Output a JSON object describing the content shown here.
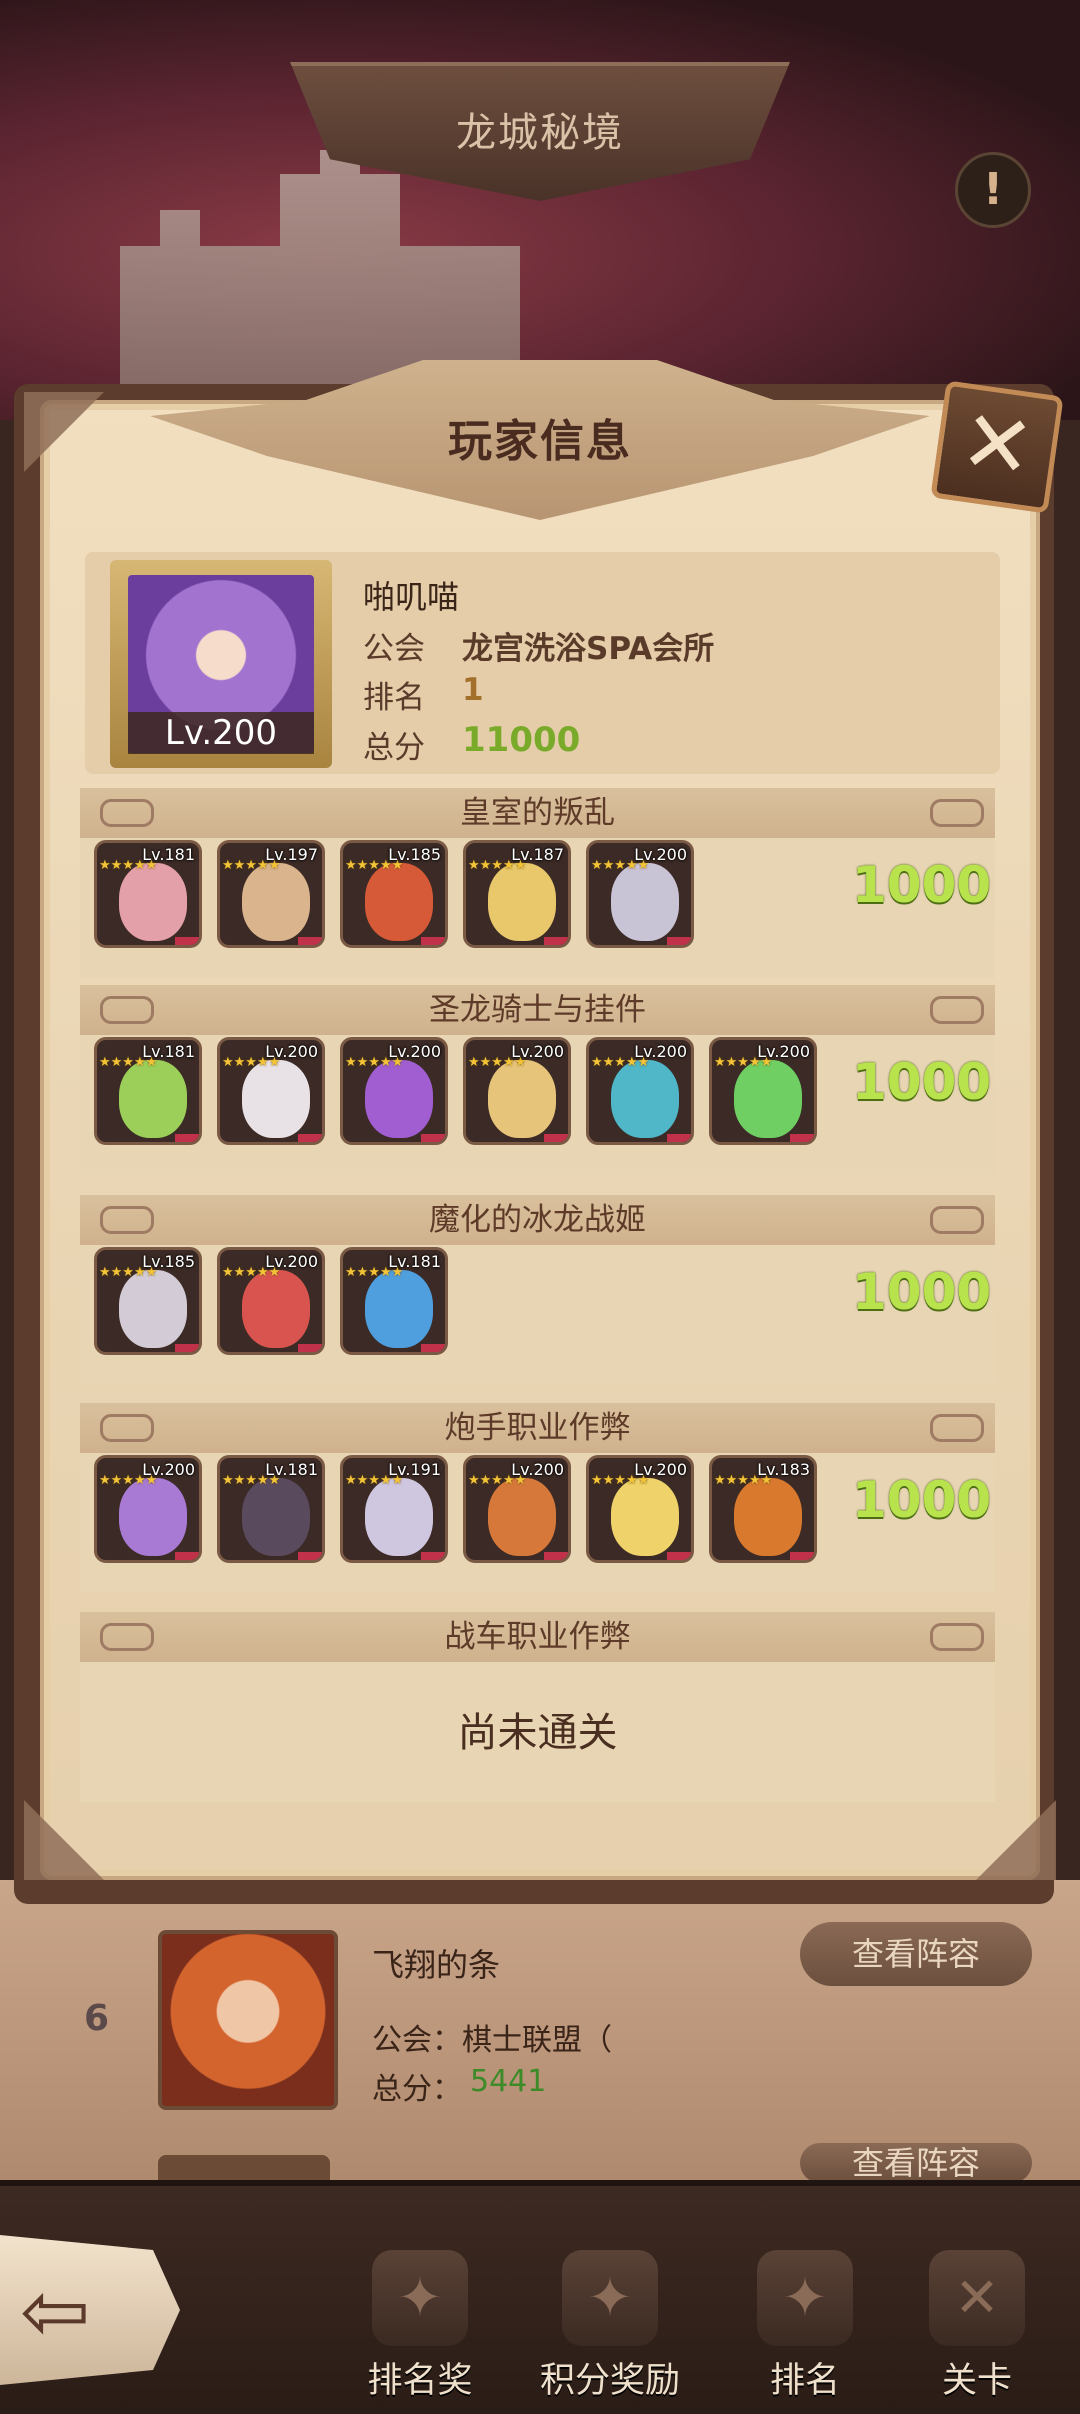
{
  "top": {
    "title": "龙城秘境",
    "alert_glyph": "!"
  },
  "modal": {
    "title": "玩家信息",
    "close_glyph": "✕"
  },
  "player": {
    "name": "啪叽喵",
    "level": "Lv.200",
    "guild_label": "公会",
    "guild_value": "龙宫洗浴SPA会所",
    "rank_label": "排名",
    "rank_value": "1",
    "score_label": "总分",
    "score_value": "11000"
  },
  "sections": [
    {
      "title": "皇室的叛乱",
      "score": "1000",
      "heroes": [
        {
          "level": "Lv.181",
          "color": "#e3a0a8"
        },
        {
          "level": "Lv.197",
          "color": "#d9b48d"
        },
        {
          "level": "Lv.185",
          "color": "#d65a37"
        },
        {
          "level": "Lv.187",
          "color": "#e8c86a"
        },
        {
          "level": "Lv.200",
          "color": "#c9c3d6"
        }
      ]
    },
    {
      "title": "圣龙骑士与挂件",
      "score": "1000",
      "heroes": [
        {
          "level": "Lv.181",
          "color": "#9ccf5a"
        },
        {
          "level": "Lv.200",
          "color": "#e8e2e6"
        },
        {
          "level": "Lv.200",
          "color": "#a05ed0"
        },
        {
          "level": "Lv.200",
          "color": "#e6c47a"
        },
        {
          "level": "Lv.200",
          "color": "#4fb7c7"
        },
        {
          "level": "Lv.200",
          "color": "#6fcf63"
        }
      ]
    },
    {
      "title": "魔化的冰龙战姬",
      "score": "1000",
      "heroes": [
        {
          "level": "Lv.185",
          "color": "#d3ccd6"
        },
        {
          "level": "Lv.200",
          "color": "#d9544f"
        },
        {
          "level": "Lv.181",
          "color": "#4f9fde"
        }
      ]
    },
    {
      "title": "炮手职业作弊",
      "score": "1000",
      "heroes": [
        {
          "level": "Lv.200",
          "color": "#a87ad4"
        },
        {
          "level": "Lv.181",
          "color": "#5a4a5e"
        },
        {
          "level": "Lv.191",
          "color": "#cfc6e0"
        },
        {
          "level": "Lv.200",
          "color": "#d6783a"
        },
        {
          "level": "Lv.200",
          "color": "#efd36a"
        },
        {
          "level": "Lv.183",
          "color": "#d8792e"
        }
      ]
    },
    {
      "title": "战车职业作弊",
      "status": "尚未通关"
    }
  ],
  "list": {
    "rank": "6",
    "name": "飞翔的条",
    "guild_text": "公会：棋士联盟（",
    "score_label": "总分：",
    "score_value": "5441",
    "view_button": "查看阵容",
    "view_button_2": "查看阵容"
  },
  "nav": {
    "back_glyph": "⇦",
    "items": [
      {
        "label": "排名奖",
        "icon": "trophy-icon"
      },
      {
        "label": "积分奖励",
        "icon": "scroll-icon"
      },
      {
        "label": "排名",
        "icon": "ranking-icon"
      },
      {
        "label": "关卡",
        "icon": "swords-icon"
      }
    ]
  }
}
